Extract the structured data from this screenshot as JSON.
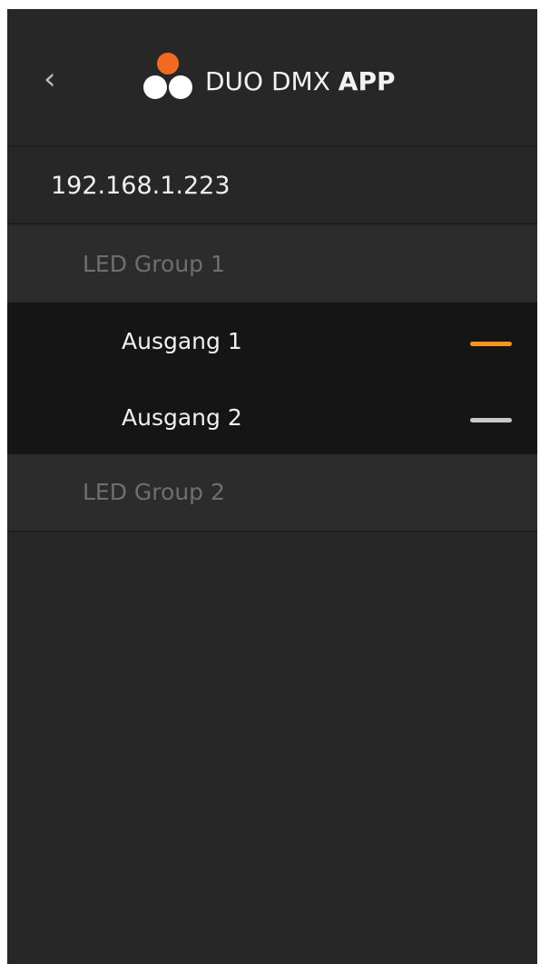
{
  "header": {
    "back_glyph": "‹",
    "title_regular": "DUO DMX ",
    "title_bold": "APP",
    "logo_colors": {
      "top": "#f26a21",
      "left": "#ffffff",
      "right": "#ffffff"
    }
  },
  "device": {
    "ip": "192.168.1.223"
  },
  "groups": [
    {
      "label": "LED Group 1",
      "outputs": [
        {
          "label": "Ausgang 1",
          "active": true,
          "indicator_color": "#f7931e"
        },
        {
          "label": "Ausgang 2",
          "active": false,
          "indicator_color": "#c8c8c8"
        }
      ]
    },
    {
      "label": "LED Group 2"
    }
  ],
  "colors": {
    "background": "#272727",
    "expanded_background": "#151515",
    "accent": "#f7931e"
  }
}
